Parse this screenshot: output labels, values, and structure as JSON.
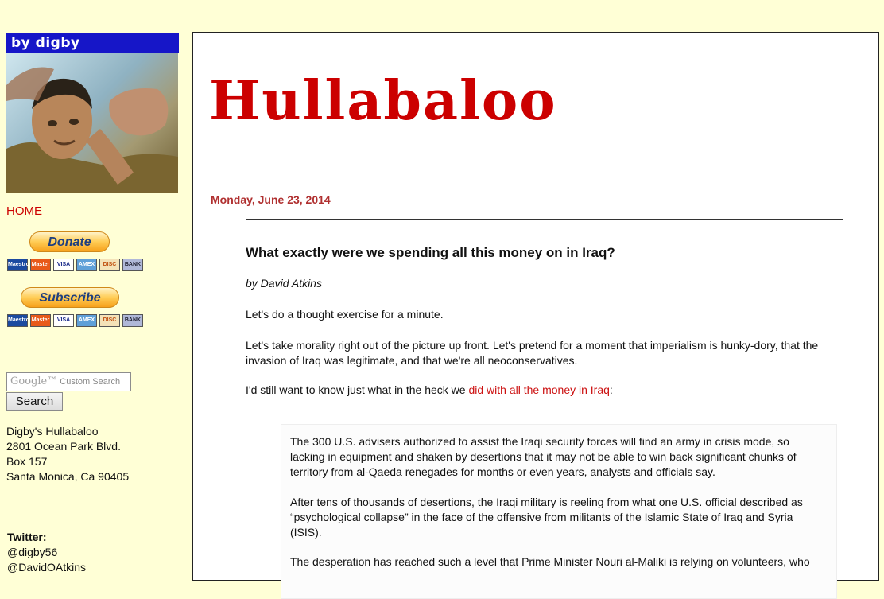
{
  "sidebar": {
    "banner": "by digby",
    "home_link": "HOME",
    "donate_label": "Donate",
    "subscribe_label": "Subscribe",
    "card_labels": [
      "Maestro",
      "Master",
      "VISA",
      "AMEX",
      "DISC",
      "BANK"
    ],
    "search": {
      "google_label": "Google™",
      "placeholder": "Custom Search",
      "button_label": "Search"
    },
    "address": [
      "Digby's Hullabaloo",
      "2801 Ocean Park Blvd.",
      "Box 157",
      "Santa Monica, Ca 90405"
    ],
    "twitter_heading": "Twitter:",
    "twitter_handles": [
      "@digby56",
      "@DavidOAtkins"
    ]
  },
  "main": {
    "blog_title": "Hullabaloo",
    "date": "Monday, June 23, 2014",
    "post": {
      "title": "What exactly were we spending all this money on in Iraq?",
      "byline": "by David Atkins",
      "p1": "Let's do a thought exercise for a minute.",
      "p2": "Let's take morality right out of the picture up front. Let's pretend for a moment that imperialism is hunky-dory, that the invasion of Iraq was legitimate, and that we're all neoconservatives.",
      "p3_before": "I'd still want to know just what in the heck we ",
      "p3_link": "did with all the money in Iraq",
      "p3_after": ":",
      "quote": {
        "q1": "The 300 U.S. advisers authorized to assist the Iraqi security forces will find an army in crisis mode, so lacking in equipment and shaken by desertions that it may not be able to win back significant chunks of territory from al-Qaeda renegades for months or even years, analysts and officials say.",
        "q2": "After tens of thousands of desertions, the Iraqi military is reeling from what one U.S. official described as “psychological collapse” in the face of the offensive from militants of the Islamic State of Iraq and Syria (ISIS).",
        "q3": "The desperation has reached such a level that Prime Minister Nouri al-Maliki is relying on volunteers, who"
      }
    }
  },
  "colors": {
    "page_background": "#ffffd6",
    "banner_blue": "#1616c8",
    "title_red": "#cc0000",
    "date_red": "#b03030",
    "link_red": "#cc1111"
  }
}
